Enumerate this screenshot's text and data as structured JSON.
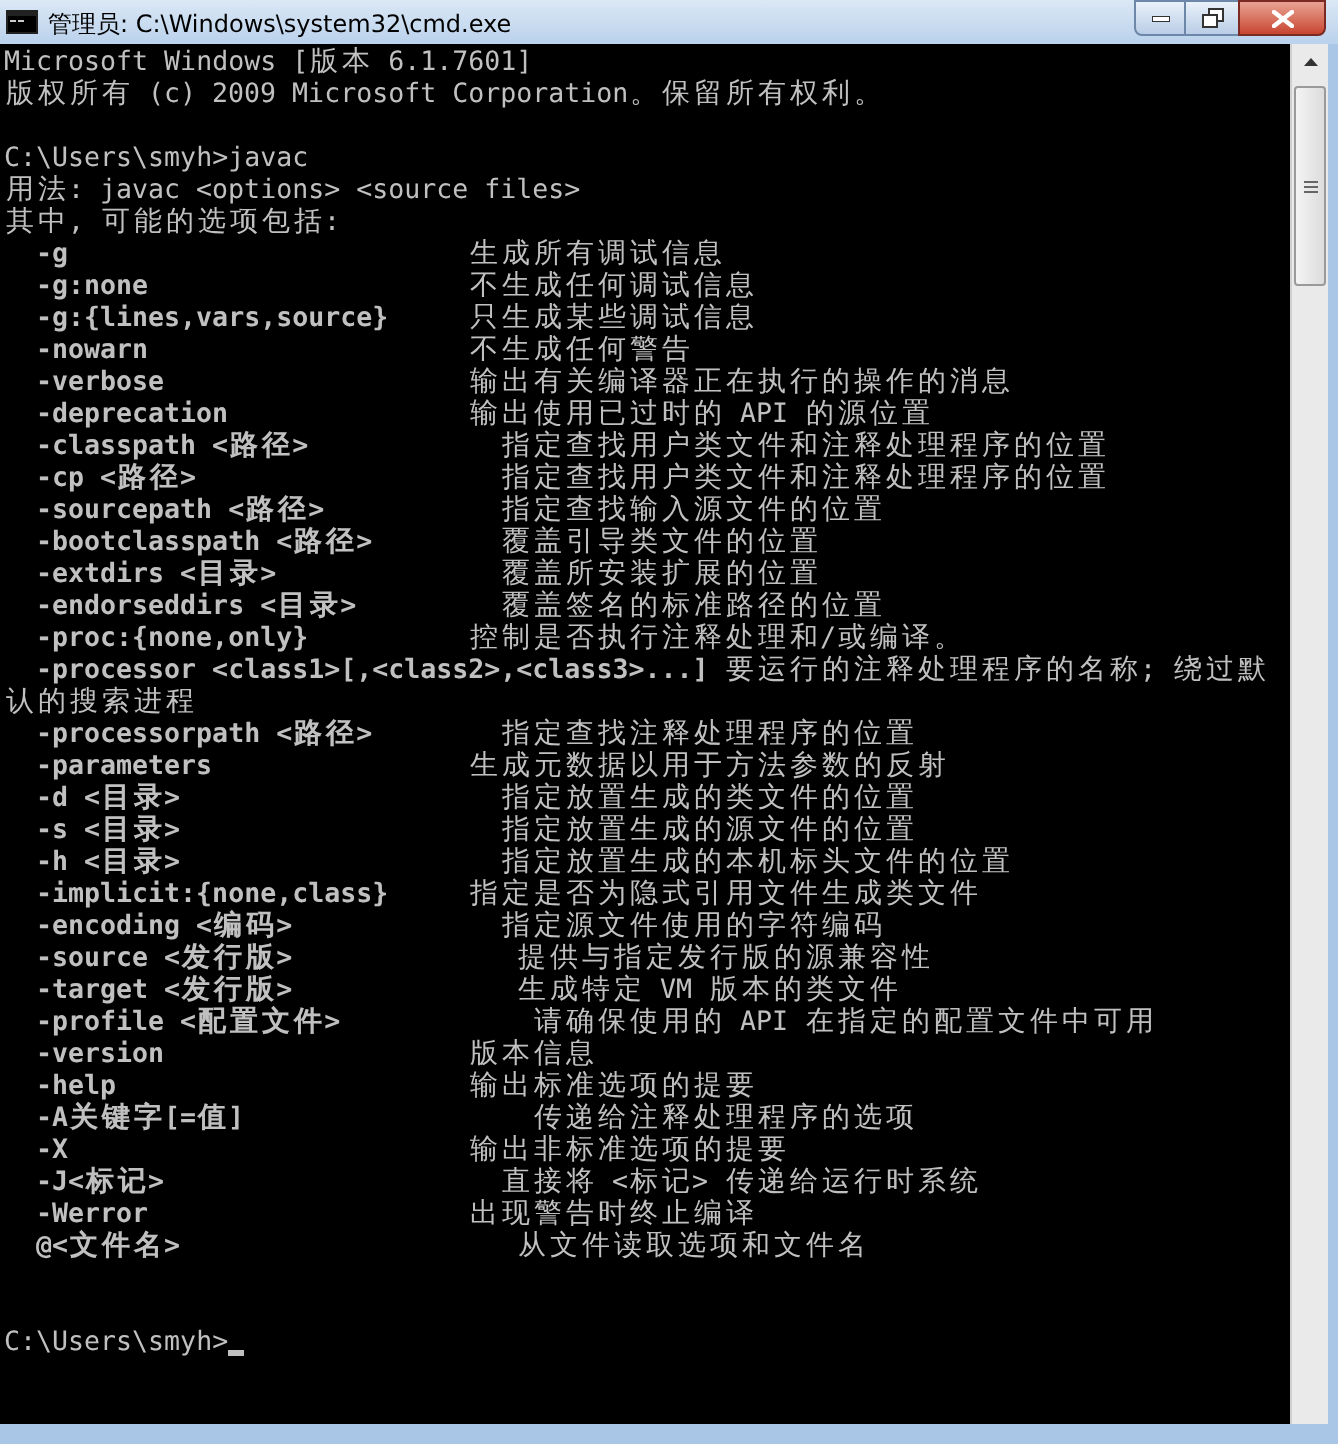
{
  "window": {
    "title": "管理员: C:\\Windows\\system32\\cmd.exe"
  },
  "console": {
    "cursor": true,
    "lines": [
      {
        "kind": "text",
        "text": "Microsoft Windows [版本 6.1.7601]"
      },
      {
        "kind": "text",
        "text": "版权所有 (c) 2009 Microsoft Corporation。保留所有权利。"
      },
      {
        "kind": "blank"
      },
      {
        "kind": "text",
        "text": "C:\\Users\\smyh>javac"
      },
      {
        "kind": "text",
        "text": "用法: javac <options> <source files>"
      },
      {
        "kind": "text",
        "text": "其中, 可能的选项包括:"
      },
      {
        "kind": "option",
        "option": "-g",
        "description": "生成所有调试信息"
      },
      {
        "kind": "option",
        "option": "-g:none",
        "description": "不生成任何调试信息"
      },
      {
        "kind": "option",
        "option": "-g:{lines,vars,source}",
        "description": "只生成某些调试信息"
      },
      {
        "kind": "option",
        "option": "-nowarn",
        "description": "不生成任何警告"
      },
      {
        "kind": "option",
        "option": "-verbose",
        "description": "输出有关编译器正在执行的操作的消息"
      },
      {
        "kind": "option",
        "option": "-deprecation",
        "description": "输出使用已过时的 API 的源位置"
      },
      {
        "kind": "option",
        "option": "-classpath <路径>",
        "description": "指定查找用户类文件和注释处理程序的位置"
      },
      {
        "kind": "option",
        "option": "-cp <路径>",
        "description": "指定查找用户类文件和注释处理程序的位置"
      },
      {
        "kind": "option",
        "option": "-sourcepath <路径>",
        "description": "指定查找输入源文件的位置"
      },
      {
        "kind": "option",
        "option": "-bootclasspath <路径>",
        "description": "覆盖引导类文件的位置"
      },
      {
        "kind": "option",
        "option": "-extdirs <目录>",
        "description": "覆盖所安装扩展的位置"
      },
      {
        "kind": "option",
        "option": "-endorseddirs <目录>",
        "description": "覆盖签名的标准路径的位置"
      },
      {
        "kind": "option",
        "option": "-proc:{none,only}",
        "description": "控制是否执行注释处理和/或编译。"
      },
      {
        "kind": "option",
        "option": "-processor <class1>[,<class2>,<class3>...]",
        "description": "要运行的注释处理程序的名称; 绕过默"
      },
      {
        "kind": "text",
        "text": "认的搜索进程"
      },
      {
        "kind": "option",
        "option": "-processorpath <路径>",
        "description": "指定查找注释处理程序的位置"
      },
      {
        "kind": "option",
        "option": "-parameters",
        "description": "生成元数据以用于方法参数的反射"
      },
      {
        "kind": "option",
        "option": "-d <目录>",
        "description": "指定放置生成的类文件的位置"
      },
      {
        "kind": "option",
        "option": "-s <目录>",
        "description": "指定放置生成的源文件的位置"
      },
      {
        "kind": "option",
        "option": "-h <目录>",
        "description": "指定放置生成的本机标头文件的位置"
      },
      {
        "kind": "option",
        "option": "-implicit:{none,class}",
        "description": "指定是否为隐式引用文件生成类文件"
      },
      {
        "kind": "option",
        "option": "-encoding <编码>",
        "description": "指定源文件使用的字符编码"
      },
      {
        "kind": "option",
        "option": "-source <发行版>",
        "description": "提供与指定发行版的源兼容性"
      },
      {
        "kind": "option",
        "option": "-target <发行版>",
        "description": "生成特定 VM 版本的类文件"
      },
      {
        "kind": "option",
        "option": "-profile <配置文件>",
        "description": "请确保使用的 API 在指定的配置文件中可用"
      },
      {
        "kind": "option",
        "option": "-version",
        "description": "版本信息"
      },
      {
        "kind": "option",
        "option": "-help",
        "description": "输出标准选项的提要"
      },
      {
        "kind": "option",
        "option": "-A关键字[=值]",
        "description": "传递给注释处理程序的选项"
      },
      {
        "kind": "option",
        "option": "-X",
        "description": "输出非标准选项的提要"
      },
      {
        "kind": "option",
        "option": "-J<标记>",
        "description": "直接将 <标记> 传递给运行时系统"
      },
      {
        "kind": "option",
        "option": "-Werror",
        "description": "出现警告时终止编译"
      },
      {
        "kind": "option",
        "option": "@<文件名>",
        "description": "从文件读取选项和文件名"
      },
      {
        "kind": "blank"
      },
      {
        "kind": "blank"
      },
      {
        "kind": "text",
        "text": "C:\\Users\\smyh>"
      }
    ]
  }
}
